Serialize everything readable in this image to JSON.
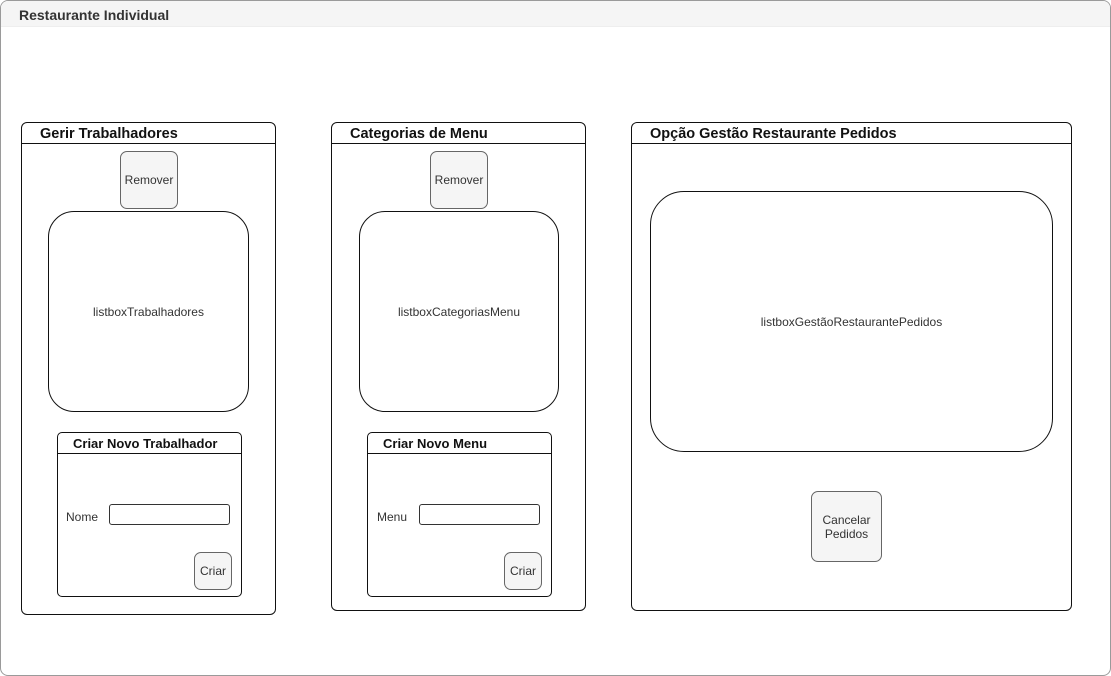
{
  "window": {
    "title": "Restaurante Individual"
  },
  "workers_panel": {
    "title": "Gerir Trabalhadores",
    "remove_label": "Remover",
    "listbox_label": "listboxTrabalhadores",
    "create": {
      "title": "Criar Novo Trabalhador",
      "field_label": "Nome",
      "field_value": "",
      "button_label": "Criar"
    }
  },
  "menu_panel": {
    "title": "Categorias de Menu",
    "remove_label": "Remover",
    "listbox_label": "listboxCategoriasMenu",
    "create": {
      "title": "Criar Novo Menu",
      "field_label": "Menu",
      "field_value": "",
      "button_label": "Criar"
    }
  },
  "orders_panel": {
    "title": "Opção Gestão Restaurante Pedidos",
    "listbox_label": "listboxGestãoRestaurantePedidos",
    "cancel_label": "Cancelar\nPedidos"
  }
}
